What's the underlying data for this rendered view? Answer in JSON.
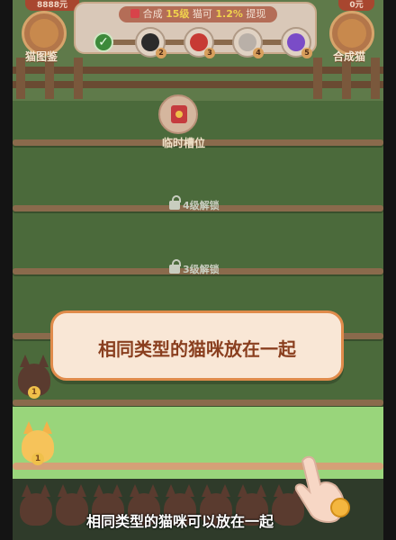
{
  "top": {
    "coins_left": "8888元",
    "coins_right": "0元",
    "left_button_label": "猫图鉴",
    "right_button_label": "合成猫",
    "banner_text_prefix": "合成",
    "banner_level": "15级",
    "banner_middle": "猫可",
    "banner_percent": "1.2%",
    "banner_suffix": "提现"
  },
  "progress": {
    "avatars": [
      {
        "number": "2",
        "color": "#2b2b2b",
        "icon": "dark-cat-icon"
      },
      {
        "number": "3",
        "color": "#c73a34",
        "icon": "red-cat-icon"
      },
      {
        "number": "4",
        "color": "#b9b0a8",
        "icon": "gray-cat-icon"
      },
      {
        "number": "5",
        "color": "#7a4cc7",
        "icon": "purple-cat-icon"
      }
    ]
  },
  "slots": {
    "temp_label": "临时槽位",
    "lock_4": "4级解锁",
    "lock_3": "3级解锁"
  },
  "tutorial": {
    "hint": "相同类型的猫咪放在一起",
    "caption": "相同类型的猫咪可以放在一起"
  },
  "cats": {
    "level_badge": "1"
  },
  "colors": {
    "accent_orange": "#e08b4b",
    "highlight_green": "#99d57b"
  }
}
